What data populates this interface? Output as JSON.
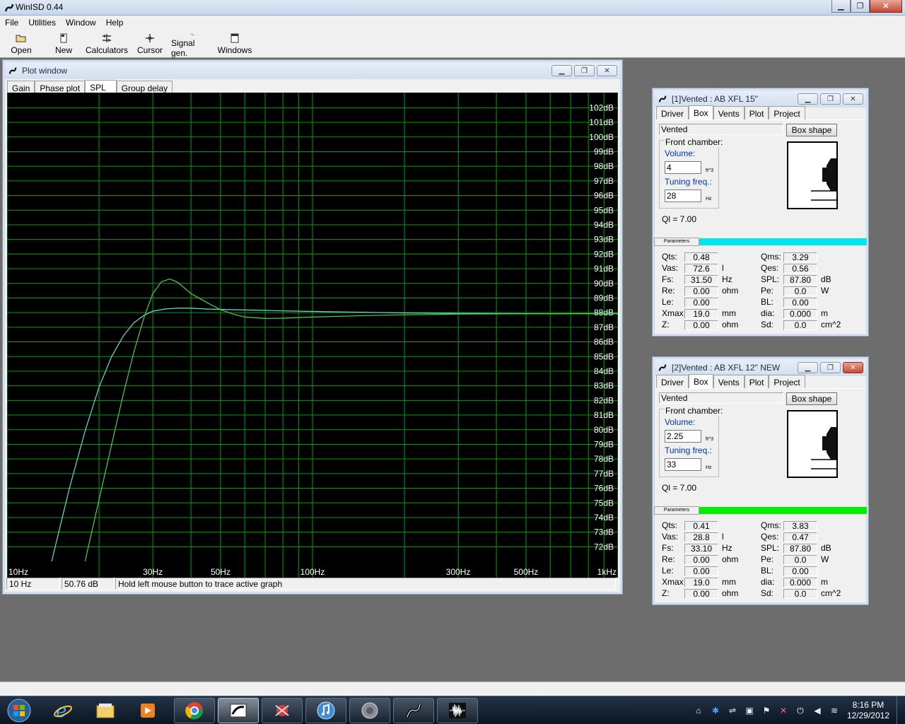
{
  "app": {
    "title": "WinISD 0.44"
  },
  "menu": [
    "File",
    "Utilities",
    "Window",
    "Help"
  ],
  "toolbar": [
    {
      "label": "Open",
      "icon": "open-folder-icon"
    },
    {
      "label": "New",
      "icon": "new-document-icon"
    },
    {
      "label": "Calculators",
      "icon": "calculator-icon"
    },
    {
      "label": "Cursor",
      "icon": "crosshair-icon"
    },
    {
      "label": "Signal gen.",
      "icon": "signal-generator-icon"
    },
    {
      "label": "Windows",
      "icon": "windows-icon"
    }
  ],
  "plot_window": {
    "title": "Plot window",
    "tabs": [
      "Gain",
      "Phase plot",
      "SPL",
      "Group delay"
    ],
    "active_tab": "SPL",
    "status": {
      "freq": "10 Hz",
      "level": "50.76 dB",
      "hint": "Hold left mouse button to trace active graph"
    }
  },
  "chart_data": {
    "type": "line",
    "xscale": "log",
    "xlim": [
      10,
      1000
    ],
    "ylim": [
      71,
      103
    ],
    "x_ticks": [
      {
        "v": 10,
        "label": "10Hz"
      },
      {
        "v": 20,
        "label": ""
      },
      {
        "v": 30,
        "label": "30Hz"
      },
      {
        "v": 40,
        "label": ""
      },
      {
        "v": 50,
        "label": "50Hz"
      },
      {
        "v": 60,
        "label": ""
      },
      {
        "v": 70,
        "label": ""
      },
      {
        "v": 80,
        "label": ""
      },
      {
        "v": 90,
        "label": ""
      },
      {
        "v": 100,
        "label": "100Hz"
      },
      {
        "v": 200,
        "label": ""
      },
      {
        "v": 300,
        "label": "300Hz"
      },
      {
        "v": 400,
        "label": ""
      },
      {
        "v": 500,
        "label": "500Hz"
      },
      {
        "v": 600,
        "label": ""
      },
      {
        "v": 700,
        "label": ""
      },
      {
        "v": 800,
        "label": ""
      },
      {
        "v": 900,
        "label": ""
      },
      {
        "v": 1000,
        "label": "1kHz"
      }
    ],
    "y_ticks": [
      72,
      73,
      74,
      75,
      76,
      77,
      78,
      79,
      80,
      81,
      82,
      83,
      84,
      85,
      86,
      87,
      88,
      89,
      90,
      91,
      92,
      93,
      94,
      95,
      96,
      97,
      98,
      99,
      100,
      101,
      102
    ],
    "y_unit": "dB",
    "grid": true,
    "colors": {
      "background": "#000000",
      "grid": "#00a000",
      "text": "#ffffff"
    },
    "series": [
      {
        "color": "#62e0e0",
        "x": [
          14,
          15,
          16,
          18,
          20,
          22,
          24,
          26,
          28,
          30,
          33,
          36,
          40,
          45,
          50,
          60,
          70,
          80,
          100,
          150,
          200,
          300,
          500,
          1000
        ],
        "y": [
          71,
          73.6,
          76,
          79.9,
          82.9,
          85.0,
          86.4,
          87.3,
          87.8,
          88.1,
          88.25,
          88.3,
          88.3,
          88.25,
          88.22,
          88.18,
          88.15,
          88.12,
          88.08,
          88.02,
          87.98,
          87.95,
          87.93,
          87.92
        ]
      },
      {
        "color": "#4cd050",
        "x": [
          18,
          20,
          22,
          24,
          26,
          28,
          30,
          32,
          34,
          36,
          38,
          40,
          45,
          50,
          55,
          60,
          70,
          80,
          100,
          150,
          200,
          300,
          500,
          1000
        ],
        "y": [
          71,
          75.2,
          79.0,
          82.4,
          85.3,
          87.6,
          89.3,
          90.1,
          90.3,
          90.1,
          89.7,
          89.3,
          88.7,
          88.2,
          87.9,
          87.7,
          87.6,
          87.62,
          87.7,
          87.8,
          87.85,
          87.9,
          87.92,
          87.94
        ]
      }
    ]
  },
  "driver_windows": [
    {
      "title": "[1]Vented : AB XFL 15\"",
      "tabs": [
        "Driver",
        "Box",
        "Vents",
        "Plot",
        "Project"
      ],
      "active_tab": "Box",
      "box_type": "Vented",
      "box_shape_button": "Box shape",
      "front_chamber": "Front chamber:",
      "volume_label": "Volume:",
      "volume": "4",
      "volume_unit": "ft^3",
      "tuning_label": "Tuning freq.:",
      "tuning": "28",
      "tuning_unit": "Hz",
      "ql": "Ql = 7.00",
      "params_tab": "Parameters",
      "accent": "#00e5ee",
      "close_red": false,
      "params_left": [
        {
          "label": "Qts:",
          "value": "0.48",
          "unit": ""
        },
        {
          "label": "Vas:",
          "value": "72.6",
          "unit": "l"
        },
        {
          "label": "Fs:",
          "value": "31.50",
          "unit": "Hz"
        },
        {
          "label": "Re:",
          "value": "0.00",
          "unit": "ohm"
        },
        {
          "label": "Le:",
          "value": "0.00",
          "unit": ""
        },
        {
          "label": "Xmax:",
          "value": "19.0",
          "unit": "mm"
        },
        {
          "label": "Z:",
          "value": "0.00",
          "unit": "ohm"
        }
      ],
      "params_right": [
        {
          "label": "Qms:",
          "value": "3.29",
          "unit": ""
        },
        {
          "label": "Qes:",
          "value": "0.56",
          "unit": ""
        },
        {
          "label": "SPL:",
          "value": "87.80",
          "unit": "dB"
        },
        {
          "label": "Pe:",
          "value": "0.0",
          "unit": "W"
        },
        {
          "label": "BL:",
          "value": "0.00",
          "unit": ""
        },
        {
          "label": "dia:",
          "value": "0.000",
          "unit": "m"
        },
        {
          "label": "Sd:",
          "value": "0.0",
          "unit": "cm^2"
        }
      ]
    },
    {
      "title": "[2]Vented : AB XFL 12\" NEW",
      "tabs": [
        "Driver",
        "Box",
        "Vents",
        "Plot",
        "Project"
      ],
      "active_tab": "Box",
      "box_type": "Vented",
      "box_shape_button": "Box shape",
      "front_chamber": "Front chamber:",
      "volume_label": "Volume:",
      "volume": "2.25",
      "volume_unit": "ft^3",
      "tuning_label": "Tuning freq.:",
      "tuning": "33",
      "tuning_unit": "Hz",
      "ql": "Ql = 7.00",
      "params_tab": "Parameters",
      "accent": "#00ee00",
      "close_red": true,
      "params_left": [
        {
          "label": "Qts:",
          "value": "0.41",
          "unit": ""
        },
        {
          "label": "Vas:",
          "value": "28.8",
          "unit": "l"
        },
        {
          "label": "Fs:",
          "value": "33.10",
          "unit": "Hz"
        },
        {
          "label": "Re:",
          "value": "0.00",
          "unit": "ohm"
        },
        {
          "label": "Le:",
          "value": "0.00",
          "unit": ""
        },
        {
          "label": "Xmax:",
          "value": "19.0",
          "unit": "mm"
        },
        {
          "label": "Z:",
          "value": "0.00",
          "unit": "ohm"
        }
      ],
      "params_right": [
        {
          "label": "Qms:",
          "value": "3.83",
          "unit": ""
        },
        {
          "label": "Qes:",
          "value": "0.47",
          "unit": ""
        },
        {
          "label": "SPL:",
          "value": "87.80",
          "unit": "dB"
        },
        {
          "label": "Pe:",
          "value": "0.0",
          "unit": "W"
        },
        {
          "label": "BL:",
          "value": "0.00",
          "unit": ""
        },
        {
          "label": "dia:",
          "value": "0.000",
          "unit": "m"
        },
        {
          "label": "Sd:",
          "value": "0.0",
          "unit": "cm^2"
        }
      ]
    }
  ],
  "taskbar": {
    "apps": [
      "start-orb-icon",
      "internet-explorer-icon",
      "explorer-folder-icon",
      "media-player-icon",
      "chrome-icon",
      "winisd-tool-icon",
      "solitaire-icon",
      "itunes-icon",
      "speaker-icon",
      "winisd-icon",
      "audio-wave-icon"
    ],
    "time": "8:16 PM",
    "date": "12/29/2012"
  }
}
